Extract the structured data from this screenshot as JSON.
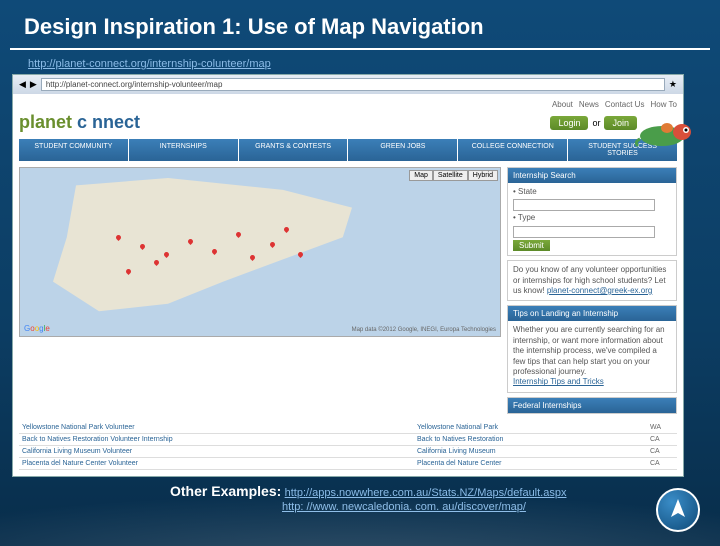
{
  "title": "Design Inspiration 1: Use of Map Navigation",
  "top_link": "http://planet-connect.org/internship-colunteer/map",
  "browser": {
    "url": "http://planet-connect.org/internship-volunteer/map"
  },
  "site": {
    "topnav": [
      "About",
      "News",
      "Contact Us",
      "How To"
    ],
    "logo1": "planet",
    "logo2": "c  nnect",
    "login": "Login",
    "or": "or",
    "join": "Join",
    "tabs": [
      "STUDENT COMMUNITY",
      "INTERNSHIPS",
      "GRANTS & CONTESTS",
      "GREEN JOBS",
      "COLLEGE CONNECTION",
      "STUDENT SUCCESS STORIES"
    ],
    "maptoggle": [
      "Map",
      "Satellite",
      "Hybrid"
    ],
    "map_credit": "Map data ©2012 Google, INEGI, Europa Technologies",
    "search": {
      "heading": "Internship Search",
      "state_lbl": "• State",
      "type_lbl": "• Type",
      "submit": "Submit"
    },
    "promo": {
      "text": "Do you know of any volunteer opportunities or internships for high school students? Let us know!",
      "link": "planet-connect@greek-ex.org"
    },
    "tips": {
      "heading": "Tips on Landing an Internship",
      "text": "Whether you are currently searching for an internship, or want more information about the internship process, we've compiled a few tips that can help start you on your professional journey.",
      "link": "Internship Tips and Tricks"
    },
    "fed": {
      "heading": "Federal Internships"
    },
    "listings": [
      [
        "Yellowstone National Park Volunteer",
        "Yellowstone National Park",
        "WA"
      ],
      [
        "Back to Natives Restoration Volunteer Internship",
        "Back to Natives Restoration",
        "CA"
      ],
      [
        "California Living Museum Volunteer",
        "California Living Museum",
        "CA"
      ],
      [
        "Placenta del Nature Center Volunteer",
        "Placenta del Nature Center",
        "CA"
      ]
    ]
  },
  "footer": {
    "label": "Other Examples:",
    "link1": "http://apps.nowwhere.com.au/Stats.NZ/Maps/default.aspx",
    "link2": "http: //www. newcaledonia. com. au/discover/map/"
  }
}
